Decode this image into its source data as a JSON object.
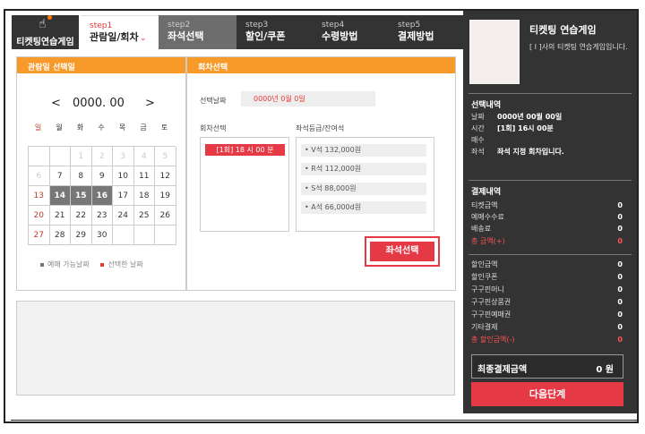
{
  "logo": {
    "label": "티켓팅연습게임",
    "icon": "hand-pointer-icon"
  },
  "steps": [
    {
      "num": "step1",
      "label": "관람일/회차"
    },
    {
      "num": "step2",
      "label": "좌석선택"
    },
    {
      "num": "step3",
      "label": "할인/쿠폰"
    },
    {
      "num": "step4",
      "label": "수령방법"
    },
    {
      "num": "step5",
      "label": "결제방법"
    }
  ],
  "date_panel": {
    "title": "관람일 선택일",
    "prev": "<",
    "month": "0000. 00",
    "next": ">",
    "weekdays": [
      "일",
      "월",
      "화",
      "수",
      "목",
      "금",
      "토"
    ],
    "days": [
      "",
      "",
      "1",
      "2",
      "3",
      "4",
      "5",
      "6",
      "7",
      "8",
      "9",
      "10",
      "11",
      "12",
      "13",
      "14",
      "15",
      "16",
      "17",
      "18",
      "19",
      "20",
      "21",
      "22",
      "23",
      "24",
      "25",
      "26",
      "27",
      "28",
      "29",
      "30",
      "",
      "",
      ""
    ],
    "legend_available": "예매 가능날짜",
    "legend_selected": "선택한 날짜"
  },
  "session_panel": {
    "title": "회차선택",
    "selected_date_label": "선택날짜",
    "selected_date_value": "0000년 0월 0일",
    "session_col_title": "회차선택",
    "session_item": "[1회] 18 시 00 분",
    "grade_col_title": "좌석등급/잔여석",
    "grades": [
      "• V석 132,000원",
      "• R석 112,000원",
      "• S석 88,000원",
      "• A석 66,000d원"
    ],
    "seat_button": "좌석선택"
  },
  "right_panel": {
    "game_title": "티켓팅 연습게임",
    "game_desc": "[ I ]사의 티켓팅 연습게임입니다.",
    "booking_head": "선택내역",
    "booking": [
      {
        "k": "날짜",
        "v": "0000년 00월 00일"
      },
      {
        "k": "시간",
        "v": "[1회] 16시 00분"
      },
      {
        "k": "매수",
        "v": ""
      },
      {
        "k": "좌석",
        "v": "좌석 지정 회차입니다."
      }
    ],
    "payment_head": "결제내역",
    "payment": [
      {
        "k": "티켓금액",
        "v": "0"
      },
      {
        "k": "예매수수료",
        "v": "0"
      },
      {
        "k": "배송료",
        "v": "0"
      },
      {
        "k": "총 금액(+)",
        "v": "0"
      }
    ],
    "discount": [
      {
        "k": "할인금액",
        "v": "0"
      },
      {
        "k": "할인쿠폰",
        "v": "0"
      },
      {
        "k": "구구핀머니",
        "v": "0"
      },
      {
        "k": "구구핀상품권",
        "v": "0"
      },
      {
        "k": "구구핀예매권",
        "v": "0"
      },
      {
        "k": "기타결제",
        "v": "0"
      },
      {
        "k": "총 할인금액(-)",
        "v": "0"
      }
    ],
    "final_label": "최종결제금액",
    "final_value": "0 원",
    "next_button": "다음단계"
  },
  "colors": {
    "accent": "#e53945",
    "header_orange": "#f79a2a",
    "dark": "#333333"
  }
}
